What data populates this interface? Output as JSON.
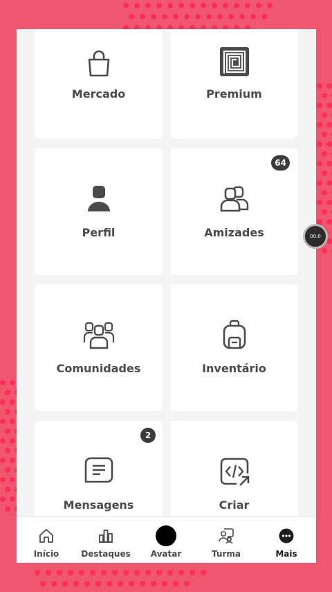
{
  "tiles": [
    {
      "label": "Mercado",
      "icon": "shopping-bag-icon"
    },
    {
      "label": "Premium",
      "icon": "premium-icon"
    },
    {
      "label": "Perfil",
      "icon": "profile-icon"
    },
    {
      "label": "Amizades",
      "icon": "friends-icon",
      "badge": "64"
    },
    {
      "label": "Comunidades",
      "icon": "communities-icon"
    },
    {
      "label": "Inventário",
      "icon": "backpack-icon"
    },
    {
      "label": "Mensagens",
      "icon": "messages-icon",
      "badge": "2"
    },
    {
      "label": "Criar",
      "icon": "create-code-icon"
    }
  ],
  "tabbar": {
    "items": [
      {
        "label": "Início",
        "icon": "home-icon"
      },
      {
        "label": "Destaques",
        "icon": "charts-icon"
      },
      {
        "label": "Avatar",
        "icon": "avatar-icon"
      },
      {
        "label": "Turma",
        "icon": "party-icon"
      },
      {
        "label": "Mais",
        "icon": "more-icon",
        "active": true
      }
    ]
  },
  "recorder": {
    "text": "00:0"
  },
  "colors": {
    "background": "#f0566f",
    "dots": "#ff2e55",
    "tile": "#ffffff",
    "icon": "#4a4a4a",
    "badge": "#393b3d"
  }
}
